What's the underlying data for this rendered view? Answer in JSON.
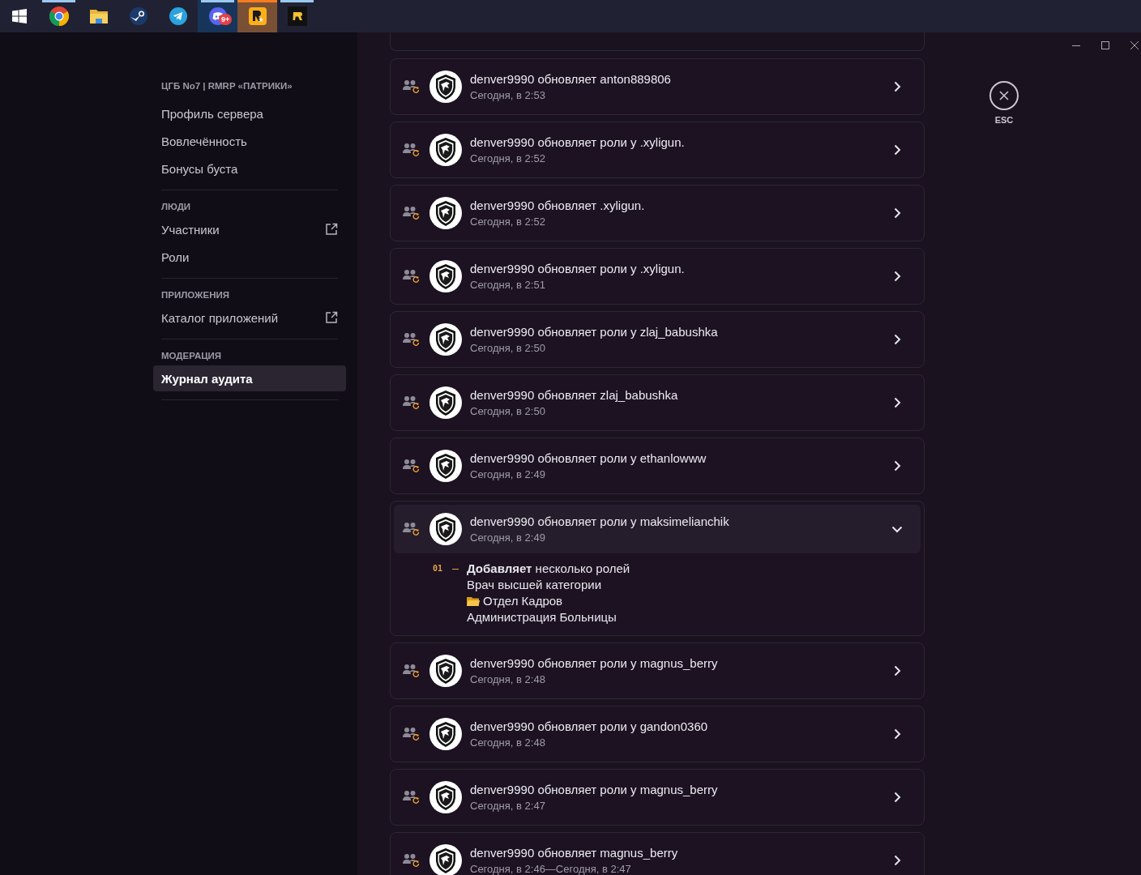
{
  "taskbar": {
    "apps": [
      {
        "kind": "chrome",
        "running": true,
        "selected": false,
        "flashing": false
      },
      {
        "kind": "folder",
        "running": false,
        "selected": false,
        "flashing": false
      },
      {
        "kind": "steam",
        "running": false,
        "selected": false,
        "flashing": false
      },
      {
        "kind": "telegram",
        "running": false,
        "selected": false,
        "flashing": false
      },
      {
        "kind": "discord",
        "running": true,
        "selected": false,
        "flashing": true,
        "badge": "9+"
      },
      {
        "kind": "rockstar",
        "running": true,
        "selected": true,
        "flashing": false
      },
      {
        "kind": "r-app",
        "running": true,
        "selected": false,
        "flashing": false
      }
    ]
  },
  "sidebar": {
    "server_name": "ЦГБ No7 | RMRP «ПАТРИКИ»",
    "sections": [
      {
        "items": [
          {
            "label": "Профиль сервера",
            "external": false,
            "selected": false
          },
          {
            "label": "Вовлечённость",
            "external": false,
            "selected": false
          },
          {
            "label": "Бонусы буста",
            "external": false,
            "selected": false
          }
        ]
      },
      {
        "heading": "ЛЮДИ",
        "items": [
          {
            "label": "Участники",
            "external": true,
            "selected": false
          },
          {
            "label": "Роли",
            "external": false,
            "selected": false
          }
        ]
      },
      {
        "heading": "ПРИЛОЖЕНИЯ",
        "items": [
          {
            "label": "Каталог приложений",
            "external": true,
            "selected": false
          }
        ]
      },
      {
        "heading": "МОДЕРАЦИЯ",
        "items": [
          {
            "label": "Журнал аудита",
            "external": false,
            "selected": true
          }
        ]
      }
    ]
  },
  "close_button": {
    "label": "ESC"
  },
  "audit_log": [
    {
      "title": "denver9990 обновляет anton889806",
      "time": "Сегодня, в 2:53",
      "expanded": false
    },
    {
      "title": "denver9990 обновляет роли у .xyligun.",
      "time": "Сегодня, в 2:52",
      "expanded": false
    },
    {
      "title": "denver9990 обновляет .xyligun.",
      "time": "Сегодня, в 2:52",
      "expanded": false
    },
    {
      "title": "denver9990 обновляет роли у .xyligun.",
      "time": "Сегодня, в 2:51",
      "expanded": false
    },
    {
      "title": "denver9990 обновляет роли у zlaj_babushka",
      "time": "Сегодня, в 2:50",
      "expanded": false
    },
    {
      "title": "denver9990 обновляет zlaj_babushka",
      "time": "Сегодня, в 2:50",
      "expanded": false
    },
    {
      "title": "denver9990 обновляет роли у ethanlowww",
      "time": "Сегодня, в 2:49",
      "expanded": false
    },
    {
      "title": "denver9990 обновляет роли у maksimelianchik",
      "time": "Сегодня, в 2:49",
      "expanded": true,
      "changes": [
        {
          "number": "01",
          "text": "**Добавляет** несколько ролей",
          "roles": [
            {
              "kind": "plain",
              "name": "Врач высшей категории"
            },
            {
              "kind": "folder",
              "name": "Отдел Кадров"
            },
            {
              "kind": "plain",
              "name": "Администрация Больницы"
            }
          ]
        }
      ]
    },
    {
      "title": "denver9990 обновляет роли у magnus_berry",
      "time": "Сегодня, в 2:48",
      "expanded": false
    },
    {
      "title": "denver9990 обновляет роли у gandon0360",
      "time": "Сегодня, в 2:48",
      "expanded": false
    },
    {
      "title": "denver9990 обновляет роли у magnus_berry",
      "time": "Сегодня, в 2:47",
      "expanded": false
    },
    {
      "title": "denver9990 обновляет magnus_berry",
      "time": "Сегодня, в 2:46—Сегодня, в 2:47",
      "expanded": false
    }
  ]
}
